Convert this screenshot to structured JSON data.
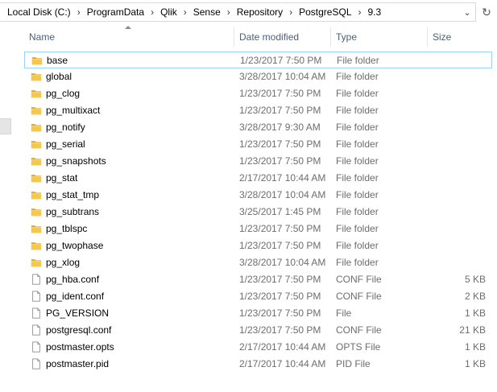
{
  "address": {
    "crumbs": [
      "Local Disk (C:)",
      "ProgramData",
      "Qlik",
      "Sense",
      "Repository",
      "PostgreSQL",
      "9.3"
    ],
    "dropdown_icon": "chevron-down-icon",
    "refresh_icon": "refresh-icon"
  },
  "columns": {
    "name": "Name",
    "date": "Date modified",
    "type": "Type",
    "size": "Size"
  },
  "files": [
    {
      "name": "base",
      "date": "1/23/2017 7:50 PM",
      "type": "File folder",
      "size": "",
      "kind": "folder",
      "selected": true
    },
    {
      "name": "global",
      "date": "3/28/2017 10:04 AM",
      "type": "File folder",
      "size": "",
      "kind": "folder"
    },
    {
      "name": "pg_clog",
      "date": "1/23/2017 7:50 PM",
      "type": "File folder",
      "size": "",
      "kind": "folder"
    },
    {
      "name": "pg_multixact",
      "date": "1/23/2017 7:50 PM",
      "type": "File folder",
      "size": "",
      "kind": "folder"
    },
    {
      "name": "pg_notify",
      "date": "3/28/2017 9:30 AM",
      "type": "File folder",
      "size": "",
      "kind": "folder"
    },
    {
      "name": "pg_serial",
      "date": "1/23/2017 7:50 PM",
      "type": "File folder",
      "size": "",
      "kind": "folder"
    },
    {
      "name": "pg_snapshots",
      "date": "1/23/2017 7:50 PM",
      "type": "File folder",
      "size": "",
      "kind": "folder"
    },
    {
      "name": "pg_stat",
      "date": "2/17/2017 10:44 AM",
      "type": "File folder",
      "size": "",
      "kind": "folder"
    },
    {
      "name": "pg_stat_tmp",
      "date": "3/28/2017 10:04 AM",
      "type": "File folder",
      "size": "",
      "kind": "folder"
    },
    {
      "name": "pg_subtrans",
      "date": "3/25/2017 1:45 PM",
      "type": "File folder",
      "size": "",
      "kind": "folder"
    },
    {
      "name": "pg_tblspc",
      "date": "1/23/2017 7:50 PM",
      "type": "File folder",
      "size": "",
      "kind": "folder"
    },
    {
      "name": "pg_twophase",
      "date": "1/23/2017 7:50 PM",
      "type": "File folder",
      "size": "",
      "kind": "folder"
    },
    {
      "name": "pg_xlog",
      "date": "3/28/2017 10:04 AM",
      "type": "File folder",
      "size": "",
      "kind": "folder"
    },
    {
      "name": "pg_hba.conf",
      "date": "1/23/2017 7:50 PM",
      "type": "CONF File",
      "size": "5 KB",
      "kind": "file"
    },
    {
      "name": "pg_ident.conf",
      "date": "1/23/2017 7:50 PM",
      "type": "CONF File",
      "size": "2 KB",
      "kind": "file"
    },
    {
      "name": "PG_VERSION",
      "date": "1/23/2017 7:50 PM",
      "type": "File",
      "size": "1 KB",
      "kind": "file"
    },
    {
      "name": "postgresql.conf",
      "date": "1/23/2017 7:50 PM",
      "type": "CONF File",
      "size": "21 KB",
      "kind": "file"
    },
    {
      "name": "postmaster.opts",
      "date": "2/17/2017 10:44 AM",
      "type": "OPTS File",
      "size": "1 KB",
      "kind": "file"
    },
    {
      "name": "postmaster.pid",
      "date": "2/17/2017 10:44 AM",
      "type": "PID File",
      "size": "1 KB",
      "kind": "file"
    }
  ],
  "colors": {
    "header_text": "#4c607a",
    "selection_border": "#99d1ff",
    "folder_yellow": "#f5c84c",
    "folder_dark": "#dcaa2e"
  }
}
